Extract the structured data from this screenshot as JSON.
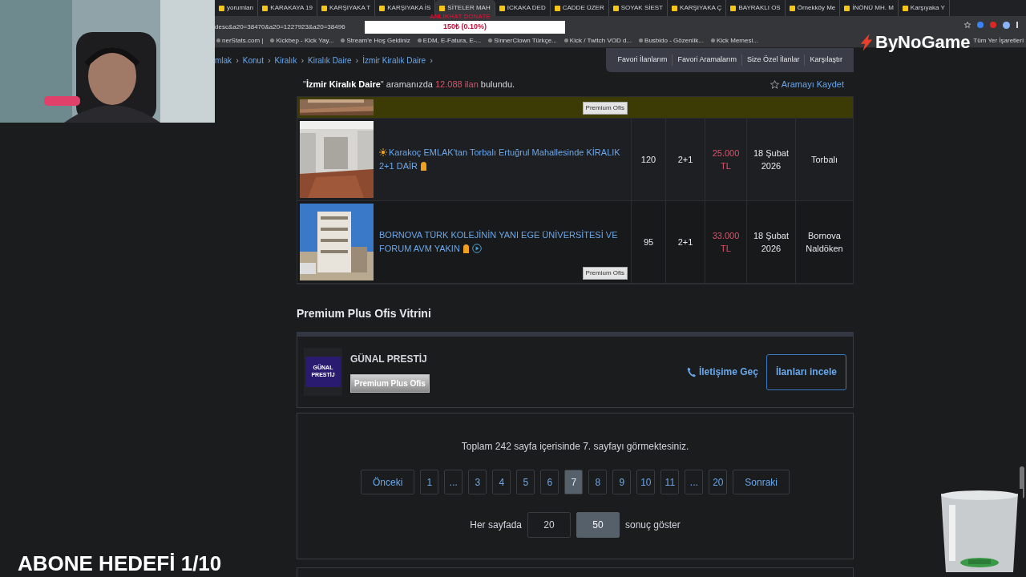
{
  "browser": {
    "tabs": [
      {
        "title": "yorumları",
        "selected": false
      },
      {
        "title": "KARAKAYA 19",
        "selected": false
      },
      {
        "title": "KARŞIYAKA T",
        "selected": false
      },
      {
        "title": "KARŞIYAKA İS",
        "selected": false
      },
      {
        "title": "SİTELER MAH",
        "selected": true
      },
      {
        "title": "ICKAKA DED",
        "selected": false
      },
      {
        "title": "CADDE ÜZER",
        "selected": false
      },
      {
        "title": "SOYAK SİEST",
        "selected": false
      },
      {
        "title": "KARŞIYAKA Ç",
        "selected": false
      },
      {
        "title": "BAYRAKLI OS",
        "selected": false
      },
      {
        "title": "Örnekköy Me",
        "selected": false
      },
      {
        "title": "İNÖNÜ MH. M",
        "selected": false
      },
      {
        "title": "Karşıyaka Y",
        "selected": false
      }
    ],
    "address": "desc&a20=38470&a20=1227923&a20=38496",
    "bookmarks": [
      "nerStats.com |",
      "Kickbep - Kick Yay...",
      "Stream'e Hoş Geldiniz",
      "EDM, E-Fatura, E-...",
      "SinnerClown Türkçe...",
      "Kick / Twitch VOD d...",
      "Busbido - Gözenlik...",
      "Kick Memesi..."
    ],
    "all_bookmarks": "Tüm Yer İşaretleri"
  },
  "overlay": {
    "donate_label": "ANLIKHAT DONATE",
    "donate_amount": "150₺ (0.10%)",
    "logo": "ByNoGame",
    "goal": "ABONE HEDEFİ 1/10"
  },
  "breadcrumb": [
    "mlak",
    "Konut",
    "Kiralık",
    "Kiralık Daire",
    "İzmir Kiralık Daire"
  ],
  "breadcrumb_separator": "›",
  "top_nav": [
    "Favori İlanlarım",
    "Favori Aramalarım",
    "Size Özel İlanlar",
    "Karşılaştır"
  ],
  "search_summary": {
    "quote_open": "\"",
    "query": "İzmir Kiralık Daire",
    "quote_close": "\"",
    "middle": "aramanızda",
    "count": "12.088 ilan",
    "end": "bulundu."
  },
  "save_search": "Aramayı Kaydet",
  "listings": [
    {
      "highlighted": true,
      "badge": "Premium Ofis"
    },
    {
      "highlighted": false,
      "featured": true,
      "has_video": false,
      "title": "Karakoç EMLAK'tan Torbalı Ertuğrul Mahallesinde KİRALIK 2+1 DAİR",
      "area": "120",
      "rooms": "2+1",
      "price": "25.000 TL",
      "date": "18 Şubat 2026",
      "location": "Torbalı"
    },
    {
      "highlighted": false,
      "featured": false,
      "has_video": true,
      "title": "BORNOVA TÜRK KOLEJİNİN YANI EGE ÜNİVERSİTESİ VE FORUM AVM YAKIN",
      "area": "95",
      "rooms": "2+1",
      "price": "33.000 TL",
      "date": "18 Şubat 2026",
      "location": "Bornova Naldöken",
      "badge": "Premium Ofis"
    }
  ],
  "office_section": {
    "title": "Premium Plus Ofis Vitrini",
    "logo_text": "GÜNAL PRESTİJ",
    "name": "GÜNAL PRESTİJ",
    "badge": "Premium Plus Ofis",
    "contact": "İletişime Geç",
    "button": "İlanları incele"
  },
  "pagination": {
    "summary": "Toplam 242 sayfa içerisinde 7. sayfayı görmektesiniz.",
    "pages": [
      {
        "label": "Önceki",
        "selected": false
      },
      {
        "label": "1",
        "selected": false
      },
      {
        "label": "...",
        "selected": false
      },
      {
        "label": "3",
        "selected": false
      },
      {
        "label": "4",
        "selected": false
      },
      {
        "label": "5",
        "selected": false
      },
      {
        "label": "6",
        "selected": false
      },
      {
        "label": "7",
        "selected": true
      },
      {
        "label": "8",
        "selected": false
      },
      {
        "label": "9",
        "selected": false
      },
      {
        "label": "10",
        "selected": false
      },
      {
        "label": "11",
        "selected": false
      },
      {
        "label": "...",
        "selected": false
      },
      {
        "label": "20",
        "selected": false
      },
      {
        "label": "Sonraki",
        "selected": false
      }
    ],
    "per_page_label": "Her sayfada",
    "per_page": [
      {
        "label": "20",
        "selected": false
      },
      {
        "label": "50",
        "selected": true
      }
    ],
    "per_page_suffix": "sonuç göster"
  }
}
